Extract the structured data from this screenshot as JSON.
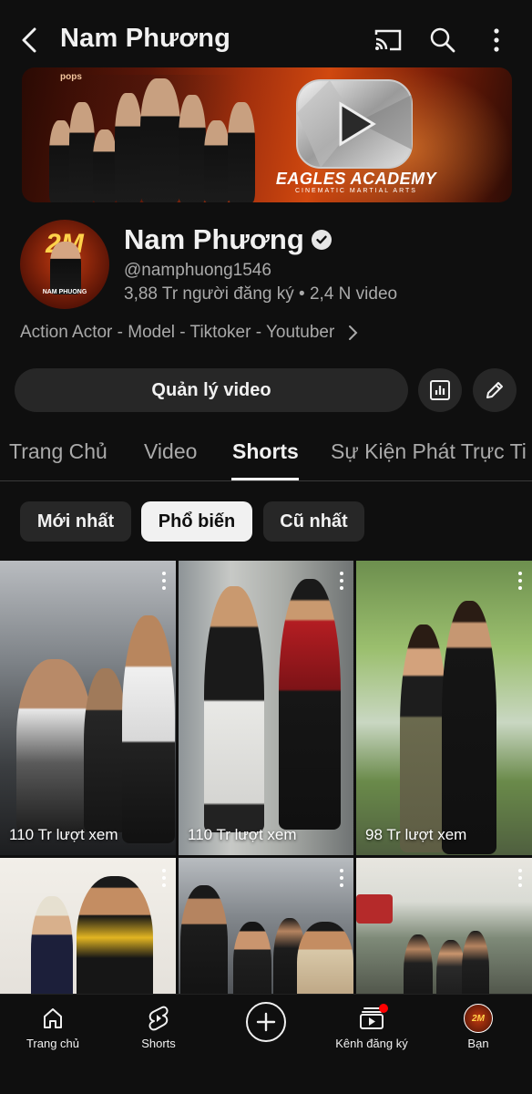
{
  "header": {
    "title": "Nam Phương"
  },
  "banner": {
    "pops_label": "pops",
    "brand": "EAGLES ACADEMY",
    "brand_sub": "CINEMATIC MARTIAL ARTS"
  },
  "channel": {
    "avatar_text": "2M",
    "avatar_label": "NAM PHUONG",
    "name": "Nam Phương",
    "handle": "@namphuong1546",
    "stats": "3,88 Tr người đăng ký • 2,4 N video",
    "description": "Action Actor - Model - Tiktoker - Youtuber"
  },
  "actions": {
    "manage_label": "Quản lý video"
  },
  "tabs": [
    {
      "label": "Trang Chủ"
    },
    {
      "label": "Video"
    },
    {
      "label": "Shorts"
    },
    {
      "label": "Sự Kiện Phát Trực Ti"
    }
  ],
  "active_tab": "Shorts",
  "chips": [
    {
      "label": "Mới nhất"
    },
    {
      "label": "Phổ biến"
    },
    {
      "label": "Cũ nhất"
    }
  ],
  "active_chip": "Phổ biến",
  "shorts": [
    {
      "views": "110 Tr lượt xem"
    },
    {
      "views": "110 Tr lượt xem"
    },
    {
      "views": "98 Tr lượt xem"
    },
    {
      "views": ""
    },
    {
      "views": ""
    },
    {
      "views": ""
    }
  ],
  "nav": [
    {
      "label": "Trang chủ",
      "icon": "home-icon"
    },
    {
      "label": "Shorts",
      "icon": "shorts-icon"
    },
    {
      "label": "",
      "icon": "create-icon"
    },
    {
      "label": "Kênh đăng ký",
      "icon": "subscriptions-icon"
    },
    {
      "label": "Bạn",
      "icon": "you-avatar"
    }
  ],
  "colors": {
    "background": "#0f0f0f",
    "chip_bg": "#272727",
    "secondary_text": "#aaaaaa",
    "notification": "#ff0000"
  }
}
